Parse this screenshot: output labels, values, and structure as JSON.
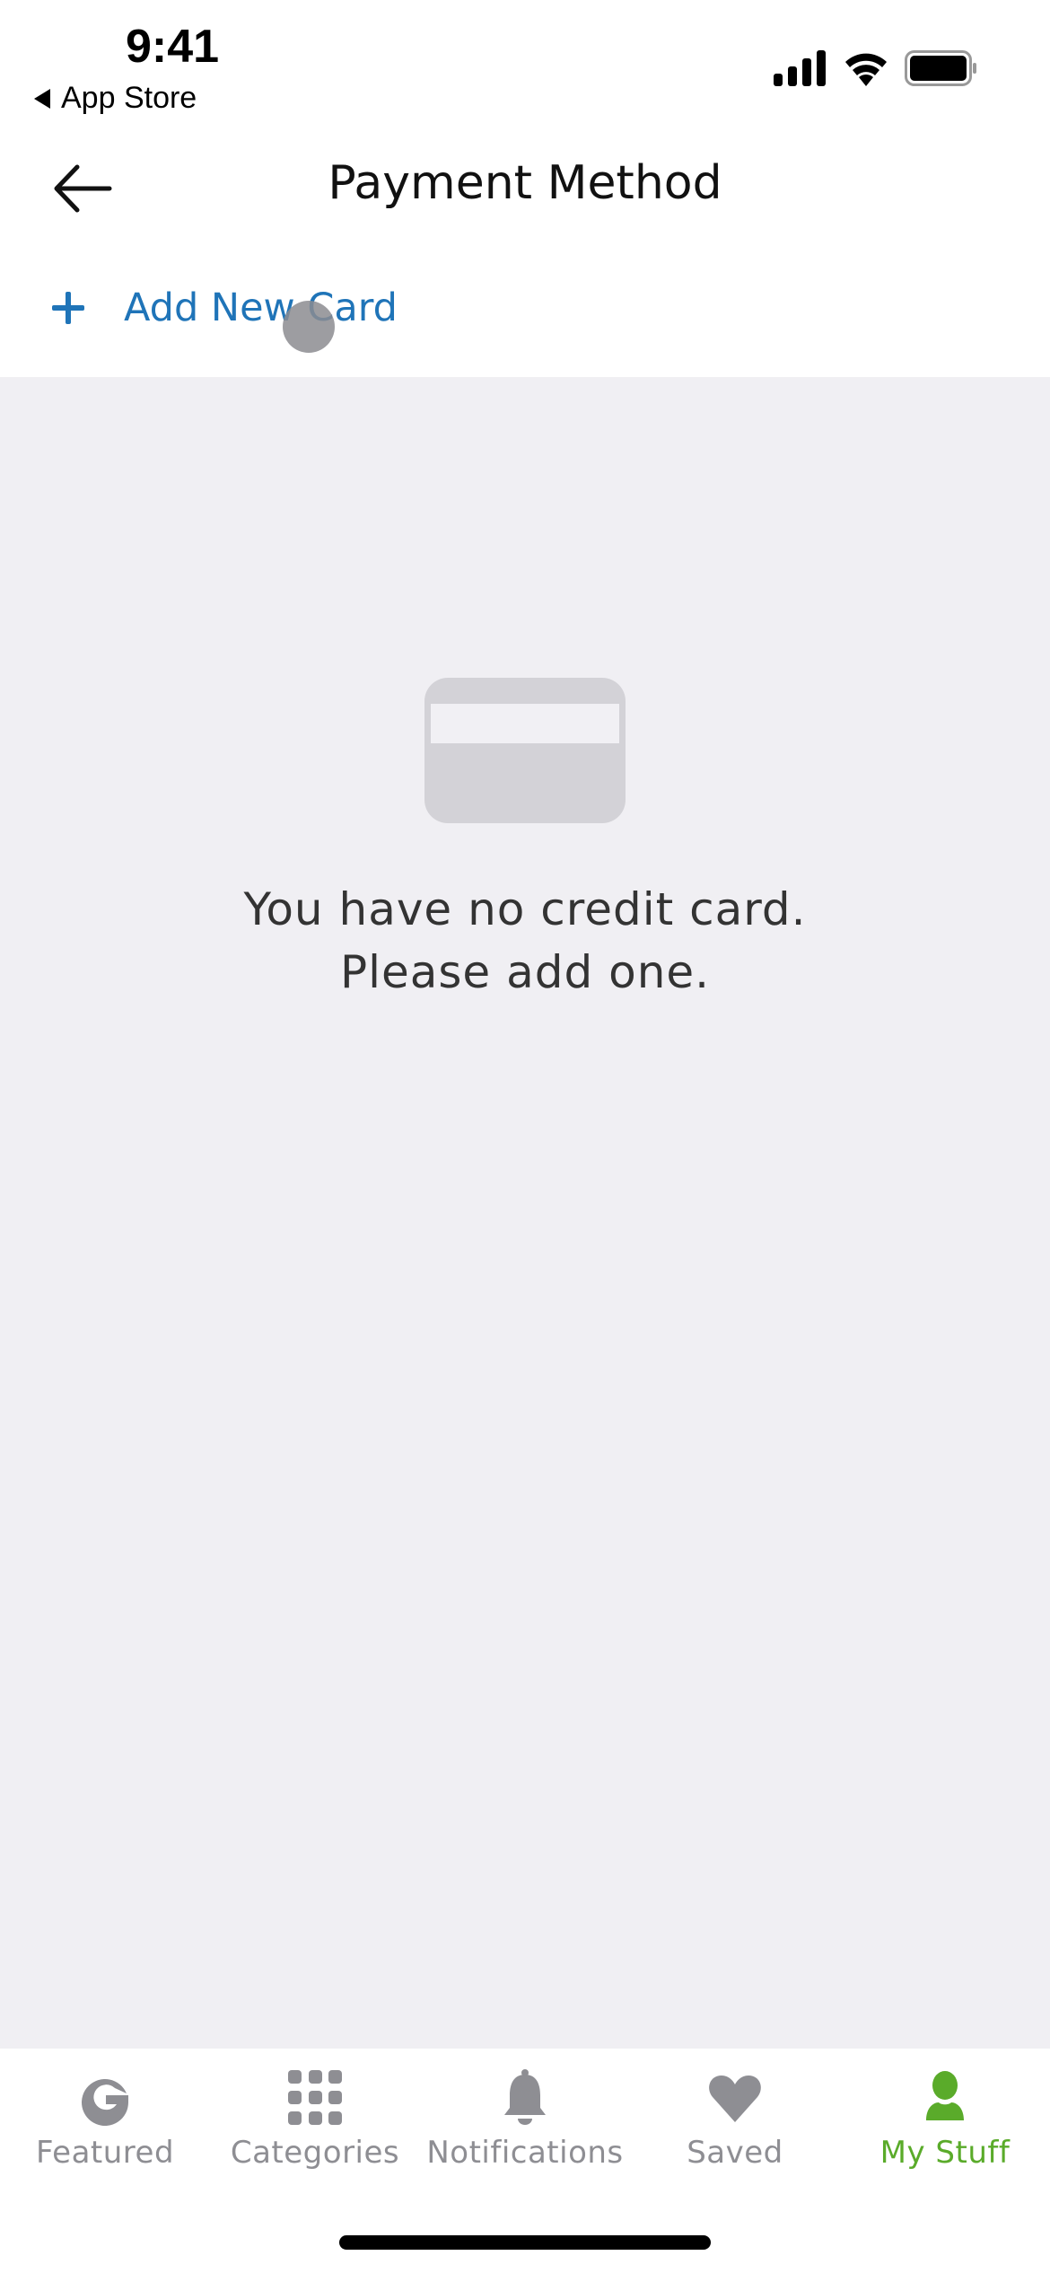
{
  "status_bar": {
    "time": "9:41",
    "back_app": "App Store",
    "icons": [
      "signal-icon",
      "wifi-icon",
      "battery-icon"
    ]
  },
  "header": {
    "title": "Payment Method",
    "back_icon": "arrow-left-icon"
  },
  "add_card": {
    "label": "Add New Card",
    "icon": "plus-icon",
    "color": "#1f74b8"
  },
  "empty_state": {
    "icon": "credit-card-icon",
    "line1": "You have no credit card.",
    "line2": "Please add one."
  },
  "tab_bar": {
    "active_color": "#5aab2a",
    "inactive_color": "#8e8e93",
    "items": [
      {
        "label": "Featured",
        "icon": "g-logo-icon",
        "active": false
      },
      {
        "label": "Categories",
        "icon": "grid-icon",
        "active": false
      },
      {
        "label": "Notifications",
        "icon": "bell-icon",
        "active": false
      },
      {
        "label": "Saved",
        "icon": "heart-icon",
        "active": false
      },
      {
        "label": "My Stuff",
        "icon": "person-icon",
        "active": true
      }
    ]
  }
}
